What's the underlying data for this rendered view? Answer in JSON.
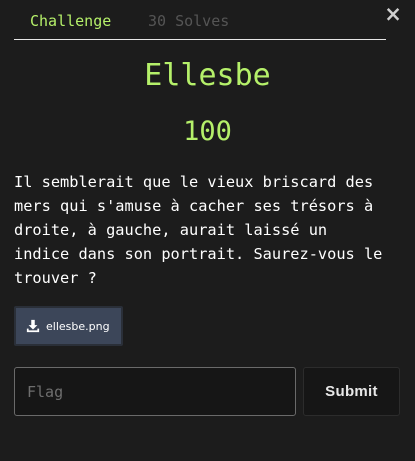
{
  "modal": {
    "close_glyph": "×"
  },
  "tabs": [
    {
      "label": "Challenge",
      "active": true
    },
    {
      "label": "30 Solves",
      "active": false
    }
  ],
  "challenge": {
    "name": "Ellesbe",
    "points": "100",
    "description": "Il semblerait que le vieux briscard des\nmers qui s'amuse à cacher ses trésors à\ndroite, à gauche, aurait laissé un\nindice dans son portrait. Saurez-vous le\ntrouver ?",
    "file": {
      "name": "ellesbe.png",
      "icon": "download-icon"
    }
  },
  "form": {
    "flag_placeholder": "Flag",
    "flag_value": "",
    "submit_label": "Submit"
  },
  "colors": {
    "background": "#1c1c1c",
    "accent": "#b5f06a",
    "file_button": "#3c4659"
  }
}
